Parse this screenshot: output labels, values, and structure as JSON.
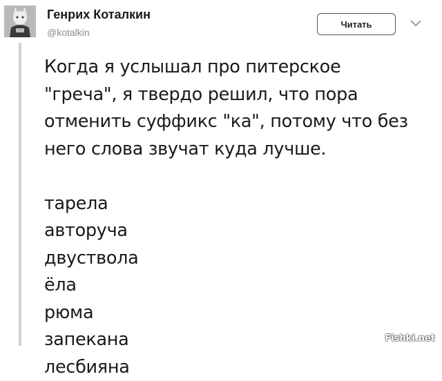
{
  "author": {
    "name": "Генрих Коталкин",
    "handle": "@kotalkin"
  },
  "follow_button": {
    "label": "Читать"
  },
  "icons": {
    "menu": "chevron-down-icon",
    "avatar": "avatar"
  },
  "tweet": {
    "paragraph_lines": [
      "Когда я услышал про питерское",
      "\"греча\", я твердо решил, что пора",
      "отменить суффикс \"ка\", потому что без",
      "него слова звучат куда лучше."
    ],
    "words": [
      "тарела",
      "авторуча",
      "двуствола",
      "ёла",
      "рюма",
      "запекана",
      "лесбияна"
    ]
  },
  "watermark": "Fishki.net"
}
